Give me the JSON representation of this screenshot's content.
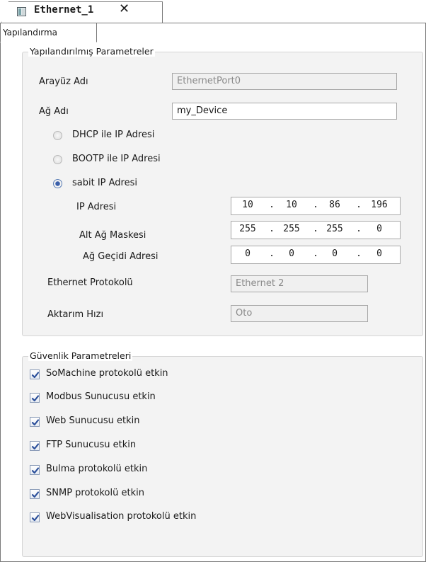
{
  "tab": {
    "title": "Ethernet_1",
    "close_glyph": "✕",
    "icon": "device-module-icon"
  },
  "subtab": {
    "label": "Yapılandırma"
  },
  "config": {
    "group_title": "Yapılandırılmış Parametreler",
    "interface_name": {
      "label": "Arayüz Adı",
      "value": "EthernetPort0"
    },
    "network_name": {
      "label": "Ağ Adı",
      "value": "my_Device"
    },
    "radios": [
      {
        "label": "DHCP ile IP Adresi",
        "checked": false
      },
      {
        "label": "BOOTP ile IP Adresi",
        "checked": false
      },
      {
        "label": "sabit IP Adresi",
        "checked": true
      }
    ],
    "ip_address": {
      "label": "IP Adresi",
      "octets": [
        "10",
        "10",
        "86",
        "196"
      ]
    },
    "subnet_mask": {
      "label": "Alt Ağ Maskesi",
      "octets": [
        "255",
        "255",
        "255",
        "0"
      ]
    },
    "gateway": {
      "label": "Ağ Geçidi Adresi",
      "octets": [
        "0",
        "0",
        "0",
        "0"
      ]
    },
    "ethernet_protocol": {
      "label": "Ethernet Protokolü",
      "value": "Ethernet 2"
    },
    "transfer_rate": {
      "label": "Aktarım Hızı",
      "value": "Oto"
    }
  },
  "security": {
    "group_title": "Güvenlik Parametreleri",
    "items": [
      {
        "label": "SoMachine protokolü etkin",
        "checked": true
      },
      {
        "label": "Modbus Sunucusu etkin",
        "checked": true
      },
      {
        "label": "Web Sunucusu etkin",
        "checked": true
      },
      {
        "label": "FTP Sunucusu etkin",
        "checked": true
      },
      {
        "label": "Bulma protokolü etkin",
        "checked": true
      },
      {
        "label": "SNMP protokolü etkin",
        "checked": true
      },
      {
        "label": "WebVisualisation protokolü etkin",
        "checked": true
      }
    ]
  },
  "colors": {
    "frame_border": "#7a7a7a",
    "group_bg": "#f3f3f3",
    "readonly_bg": "#f0f0f0",
    "check_blue": "#2b4f9a"
  }
}
